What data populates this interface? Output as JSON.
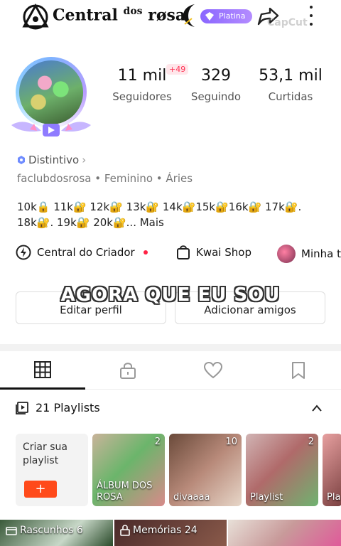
{
  "header": {
    "title_main": "Central",
    "title_dos": "dos",
    "title_rosa": "røsa",
    "badge": "Platina",
    "watermark": "CapCut"
  },
  "profile": {
    "stats": [
      {
        "value": "11 mil",
        "label": "Seguidores"
      },
      {
        "value": "329",
        "label": "Seguindo"
      },
      {
        "value": "53,1 mil",
        "label": "Curtidas"
      }
    ],
    "followers_delta": "+49",
    "distintivo": "Distintivo",
    "meta": "faclubdosrosa • Feminino • Áries",
    "bio_line1": "10k🔒 11k🔐 12k🔐 13k🔐 14k🔐15k🔐16k🔐 17k🔐.",
    "bio_line2": "18k🔐. 19k🔐 20k🔐... Mais"
  },
  "links": {
    "creator": "Central do Criador",
    "shop": "Kwai Shop",
    "mine": "Minha t"
  },
  "caption": "AGORA QUE EU SOU",
  "buttons": {
    "edit": "Editar perfil",
    "add": "Adicionar amigos"
  },
  "playlists": {
    "header": "21 Playlists",
    "create_label": "Criar sua playlist",
    "create_plus": "+",
    "cards": [
      {
        "name": "ÁLBUM DOS ROSA",
        "count": "2"
      },
      {
        "name": "divaaaa",
        "count": "10"
      },
      {
        "name": "Playlist",
        "count": "2"
      },
      {
        "name": "Pla",
        "count": ""
      }
    ]
  },
  "bottom": {
    "drafts": "Rascunhos 6",
    "memories": "Memórias 24"
  },
  "colors": {
    "accent": "#ff4a1a",
    "badge": "#8a66ff",
    "delta": "#ff3355"
  }
}
